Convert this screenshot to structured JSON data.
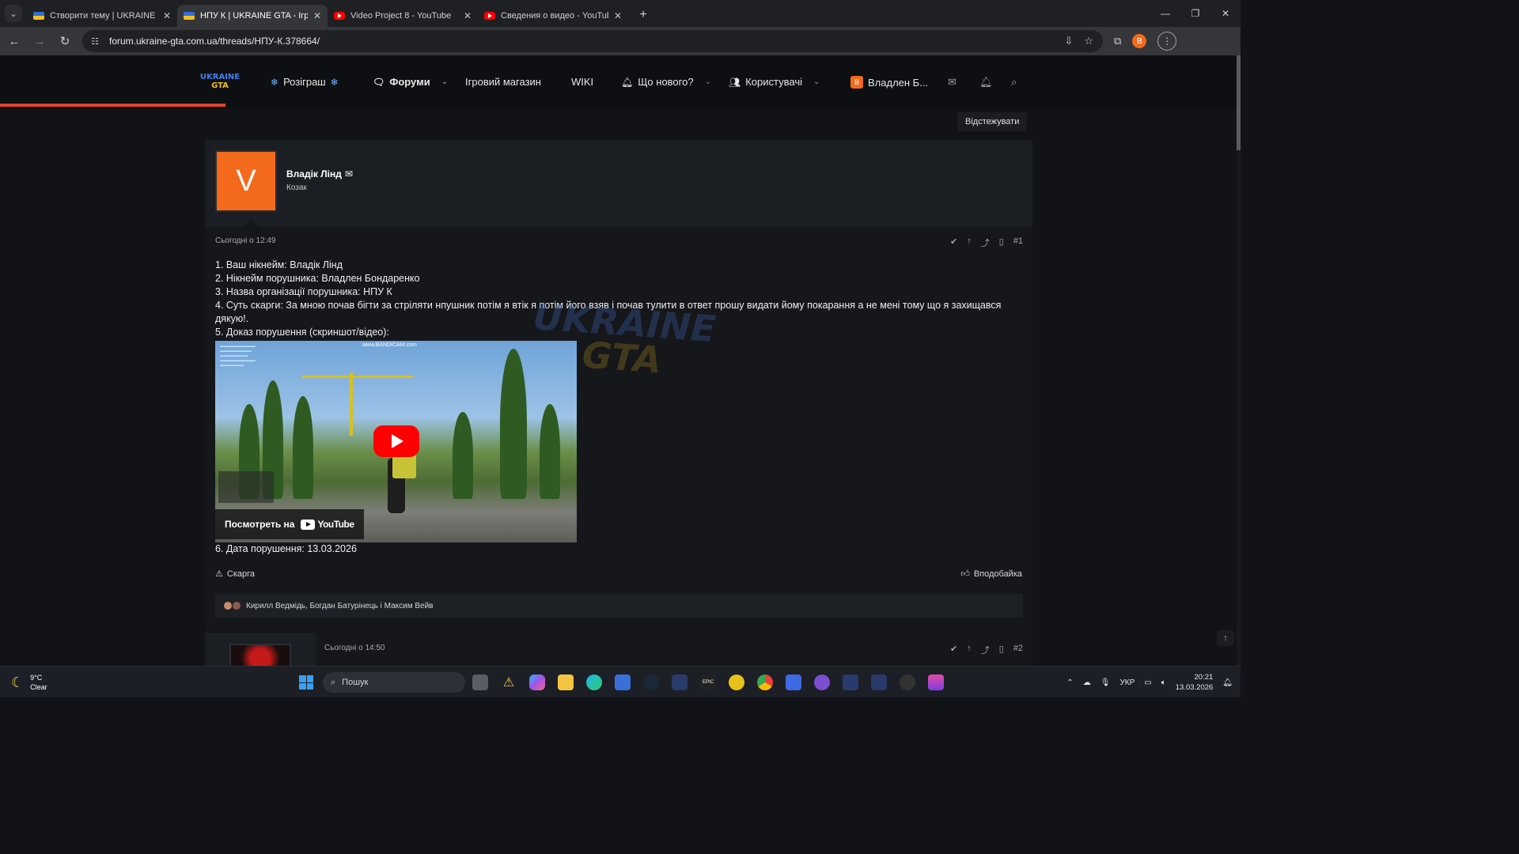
{
  "browser": {
    "tabs": [
      {
        "title": "Створити тему | UKRAINE GTA",
        "favicon": "gta-favicon",
        "active": false
      },
      {
        "title": "НПУ К | UKRAINE GTA - Ігрови",
        "favicon": "gta-favicon",
        "active": true
      },
      {
        "title": "Video Project 8 - YouTube",
        "favicon": "youtube-favicon",
        "active": false
      },
      {
        "title": "Сведения о видео - YouTube S",
        "favicon": "youtube-favicon",
        "active": false
      }
    ],
    "url": "forum.ukraine-gta.com.ua/threads/НПУ-К.378664/",
    "profile_initial": "B"
  },
  "forum": {
    "logo": {
      "line1": "UKRAINE",
      "line2": "GTA"
    },
    "nav": {
      "giveaway": "Розіграш",
      "forums": "Форуми",
      "shop": "Ігровий магазин",
      "wiki": "WIKI",
      "whats_new": "Що нового?",
      "users": "Користувачі",
      "user_name": "Владлен Б...",
      "user_initial": "B"
    },
    "watch_button": "Відстежувати"
  },
  "post1": {
    "avatar_letter": "V",
    "author": "Владік Лінд",
    "user_title": "Козак",
    "date": "Сьогодні о 12:49",
    "number": "#1",
    "lines": [
      "1. Ваш нікнейм: Владік Лінд",
      "2. Нікнейм порушника: Владлен Бондаренко",
      "3. Назва організації порушника: НПУ К",
      "4. Суть скарги: За мною почав бігти за стріляти нпушник потім я втік я потім його взяв і почав тулити в ответ прошу видати йому покарання а не мені тому що я захищався дякую!.",
      "5. Доказ порушення (скриншот/відео):"
    ],
    "video": {
      "watch_on": "Посмотреть на",
      "platform": "YouTube",
      "overlay_site": "www.BANDICAM.com"
    },
    "date_line": "6. Дата порушення: 13.03.2026",
    "complain": "Скарга",
    "like": "Вподобайка",
    "reactions": "Кирилл Ведмідь, Богдан Батурінець і Максим Вейв"
  },
  "post2": {
    "date": "Сьогодні о 14:50",
    "number": "#2"
  },
  "watermark": {
    "line1": "UKRAINE",
    "line2": "GTA"
  },
  "taskbar": {
    "weather_temp": "9°C",
    "weather_desc": "Clear",
    "search_placeholder": "Пошук",
    "language": "УКР",
    "time": "20:21",
    "date": "13.03.2026"
  }
}
